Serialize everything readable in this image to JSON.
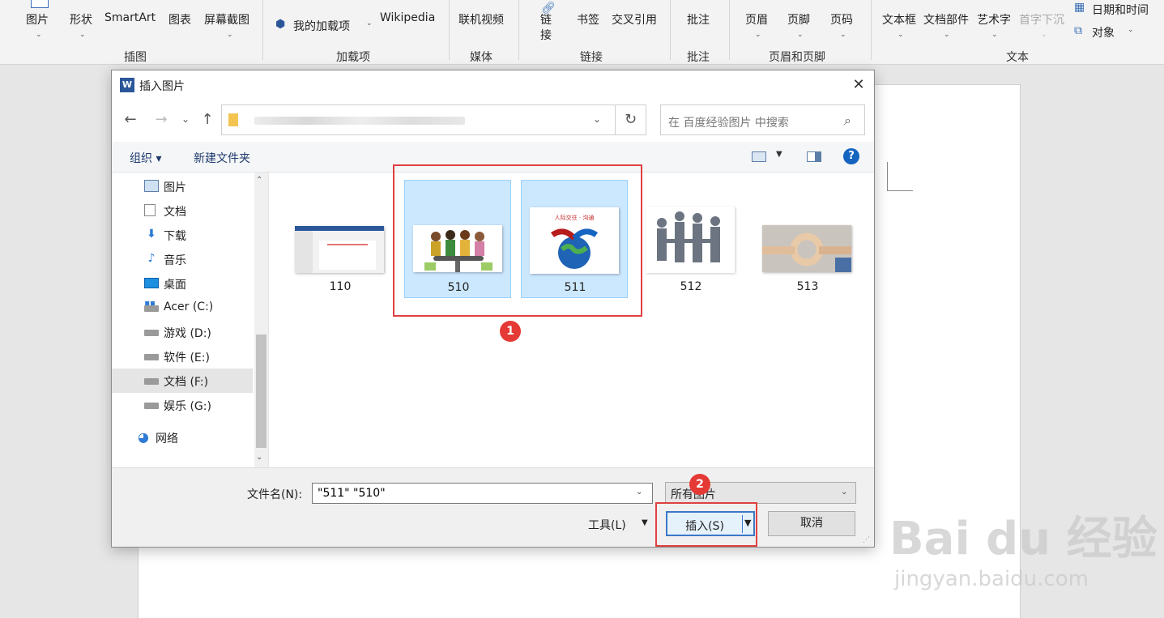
{
  "ribbon": {
    "buttons": [
      {
        "label": "图片",
        "id": "pictures"
      },
      {
        "label": "形状",
        "id": "shapes"
      },
      {
        "label": "SmartArt",
        "id": "smartart"
      },
      {
        "label": "图表",
        "id": "chart"
      },
      {
        "label": "屏幕截图",
        "id": "screenshot"
      },
      {
        "label": "我的加载项",
        "id": "my-addins"
      },
      {
        "label": "Wikipedia",
        "id": "wikipedia"
      },
      {
        "label": "联机视频",
        "id": "online-video"
      },
      {
        "label": "链",
        "id": "link-1"
      },
      {
        "label": "接",
        "id": "link-2"
      },
      {
        "label": "书签",
        "id": "bookmark"
      },
      {
        "label": "交叉引用",
        "id": "cross-ref"
      },
      {
        "label": "批注",
        "id": "comment"
      },
      {
        "label": "页眉",
        "id": "header"
      },
      {
        "label": "页脚",
        "id": "footer"
      },
      {
        "label": "页码",
        "id": "page-number"
      },
      {
        "label": "文本框",
        "id": "text-box"
      },
      {
        "label": "文档部件",
        "id": "quick-parts"
      },
      {
        "label": "艺术字",
        "id": "wordart"
      },
      {
        "label": "首字下沉",
        "id": "drop-cap"
      },
      {
        "label": "日期和时间",
        "id": "date-time"
      },
      {
        "label": "对象",
        "id": "object"
      }
    ],
    "groups": [
      "插图",
      "加载项",
      "媒体",
      "链接",
      "批注",
      "页眉和页脚",
      "文本"
    ]
  },
  "dialog": {
    "title": "插入图片",
    "app_icon_letter": "W",
    "search_placeholder": "在 百度经验图片 中搜索",
    "toolbar": {
      "organize": "组织 ▾",
      "new_folder": "新建文件夹",
      "help": "?"
    },
    "nav": [
      {
        "label": "图片",
        "icon": "pictures-icon"
      },
      {
        "label": "文档",
        "icon": "documents-icon"
      },
      {
        "label": "下载",
        "icon": "downloads-icon"
      },
      {
        "label": "音乐",
        "icon": "music-icon"
      },
      {
        "label": "桌面",
        "icon": "desktop-icon"
      },
      {
        "label": "Acer (C:)",
        "icon": "windows-drive-icon"
      },
      {
        "label": "游戏 (D:)",
        "icon": "drive-icon"
      },
      {
        "label": "软件 (E:)",
        "icon": "drive-icon"
      },
      {
        "label": "文档 (F:)",
        "icon": "drive-icon",
        "selected": true
      },
      {
        "label": "娱乐 (G:)",
        "icon": "drive-icon"
      },
      {
        "label": "网络",
        "icon": "network-icon"
      }
    ],
    "files": [
      {
        "name": "110",
        "selected": false
      },
      {
        "name": "510",
        "selected": true
      },
      {
        "name": "511",
        "selected": true,
        "caption": "人际交往 · 沟通"
      },
      {
        "name": "512",
        "selected": false
      },
      {
        "name": "513",
        "selected": false
      }
    ],
    "filename_label": "文件名(N):",
    "filename_value": "\"511\" \"510\"",
    "filetype_value": "所有图片",
    "tools_label": "工具(L)",
    "insert_label": "插入(S)",
    "cancel_label": "取消"
  },
  "annotations": {
    "badge1": "1",
    "badge2": "2"
  },
  "watermark": {
    "brand": "Bai du 经验",
    "url": "jingyan.baidu.com"
  }
}
